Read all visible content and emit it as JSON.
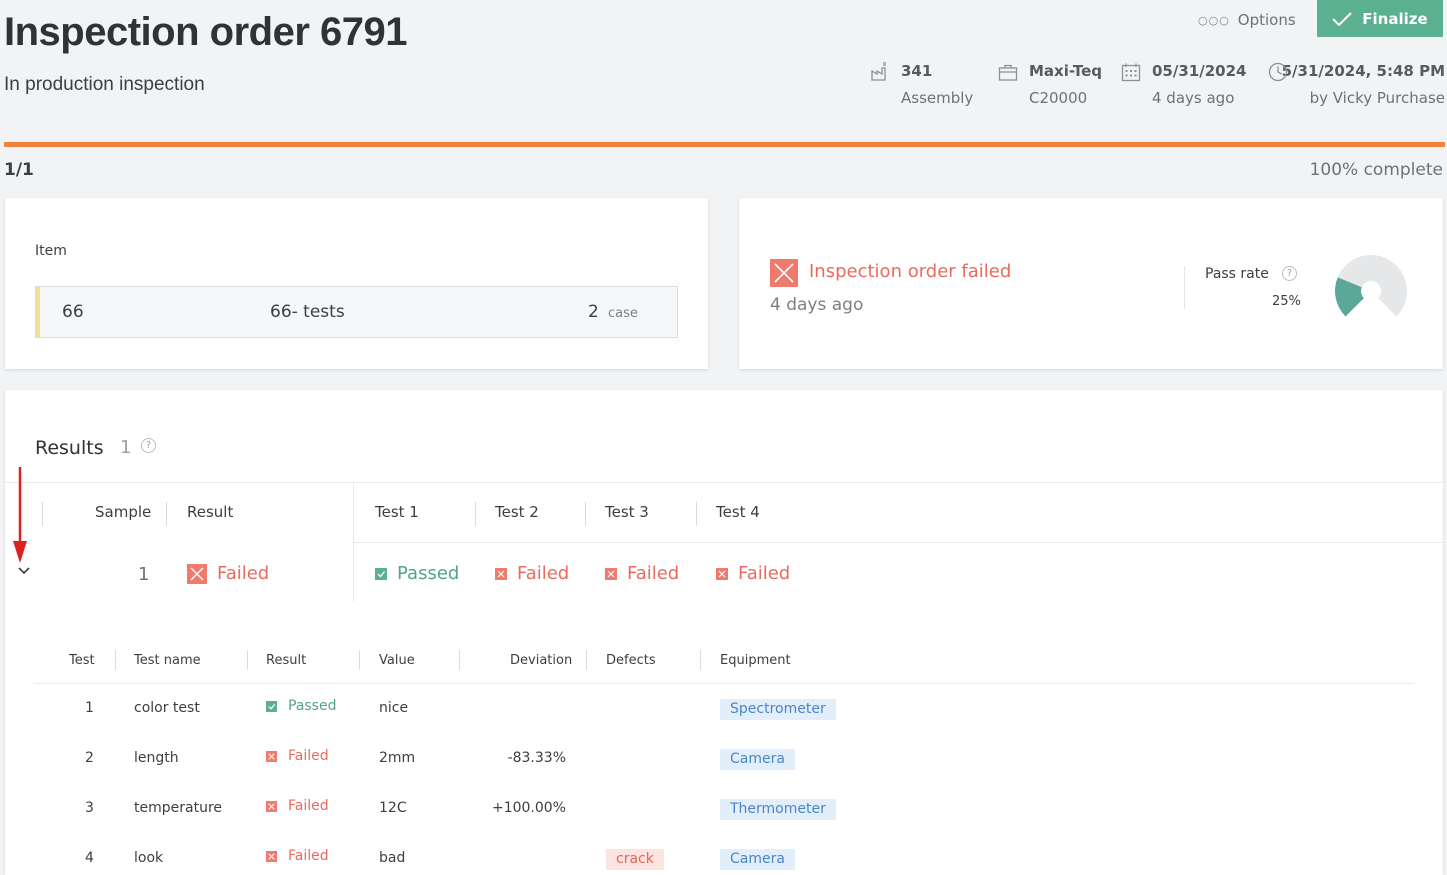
{
  "header": {
    "title": "Inspection order 6791",
    "subtitle": "In production inspection",
    "options_label": "Options",
    "finalize_label": "Finalize",
    "meta": [
      {
        "icon": "factory-icon",
        "line1": "341",
        "line2": "Assembly"
      },
      {
        "icon": "briefcase-icon",
        "line1": "Maxi-Teq",
        "line2": "C20000"
      },
      {
        "icon": "calendar-icon",
        "line1": "05/31/2024",
        "line2": "4 days ago"
      },
      {
        "icon": "clock-icon",
        "line1": "5/31/2024, 5:48 PM",
        "line2": "by Vicky Purchase"
      }
    ]
  },
  "progress": {
    "left": "1/1",
    "right": "100% complete",
    "fraction": 1.0,
    "color": "#f2823a"
  },
  "item_card": {
    "label": "Item",
    "code": "66",
    "name": "66- tests",
    "quantity": "2",
    "unit": "case"
  },
  "status_card": {
    "status": "Inspection order failed",
    "time": "4 days ago",
    "pass_rate_label": "Pass rate",
    "pass_rate_value": "25%",
    "pass_rate_fraction": 0.25,
    "colors": {
      "pass": "#5ba79a",
      "rest": "#e6e7e8",
      "failed": "#e96b5d"
    }
  },
  "results": {
    "title": "Results",
    "count": "1",
    "headers": {
      "sample": "Sample",
      "result": "Result",
      "tests": [
        "Test 1",
        "Test 2",
        "Test 3",
        "Test 4"
      ]
    },
    "rows": [
      {
        "sample": "1",
        "result": "Failed",
        "tests": [
          {
            "label": "Passed",
            "state": "passed"
          },
          {
            "label": "Failed",
            "state": "failed"
          },
          {
            "label": "Failed",
            "state": "failed"
          },
          {
            "label": "Failed",
            "state": "failed"
          }
        ]
      }
    ],
    "detail": {
      "headers": [
        "Test",
        "Test name",
        "Result",
        "Value",
        "Deviation",
        "Defects",
        "Equipment"
      ],
      "rows": [
        {
          "test": "1",
          "name": "color test",
          "result": "Passed",
          "state": "passed",
          "value": "nice",
          "deviation": "",
          "defect": "",
          "equipment": "Spectrometer"
        },
        {
          "test": "2",
          "name": "length",
          "result": "Failed",
          "state": "failed",
          "value": "2mm",
          "deviation": "-83.33%",
          "defect": "",
          "equipment": "Camera"
        },
        {
          "test": "3",
          "name": "temperature",
          "result": "Failed",
          "state": "failed",
          "value": "12C",
          "deviation": "+100.00%",
          "defect": "",
          "equipment": "Thermometer"
        },
        {
          "test": "4",
          "name": "look",
          "result": "Failed",
          "state": "failed",
          "value": "bad",
          "deviation": "",
          "defect": "crack",
          "equipment": "Camera"
        }
      ]
    }
  },
  "colors": {
    "accent_green": "#5ab090",
    "failed_red": "#e96b5d",
    "annotation_arrow": "#e02020"
  }
}
